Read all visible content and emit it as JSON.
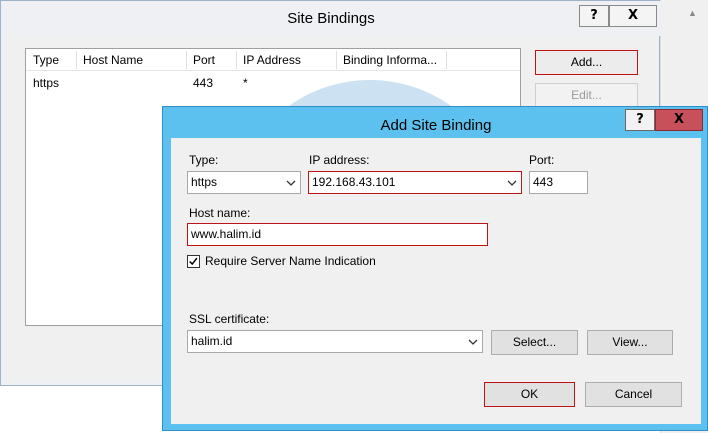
{
  "site_bindings": {
    "title": "Site Bindings",
    "help_label": "?",
    "close_label": "X",
    "columns": [
      "Type",
      "Host Name",
      "Port",
      "IP Address",
      "Binding Informa..."
    ],
    "rows": [
      {
        "type": "https",
        "host_name": "",
        "port": "443",
        "ip_address": "*",
        "binding_info": ""
      }
    ],
    "buttons": {
      "add": "Add...",
      "edit": "Edit..."
    }
  },
  "add_site_binding": {
    "title": "Add Site Binding",
    "help_label": "?",
    "close_label": "X",
    "type": {
      "label": "Type:",
      "value": "https"
    },
    "ip_address": {
      "label": "IP address:",
      "value": "192.168.43.101"
    },
    "port": {
      "label": "Port:",
      "value": "443"
    },
    "host_name": {
      "label": "Host name:",
      "value": "www.halim.id"
    },
    "require_sni": {
      "label": "Require Server Name Indication",
      "checked": true
    },
    "ssl_certificate": {
      "label": "SSL certificate:",
      "value": "halim.id"
    },
    "buttons": {
      "select": "Select...",
      "view": "View...",
      "ok": "OK",
      "cancel": "Cancel"
    }
  },
  "colors": {
    "accent_blue": "#5cc1ee",
    "focus_red": "#c01414",
    "close_red": "#c7505a"
  }
}
